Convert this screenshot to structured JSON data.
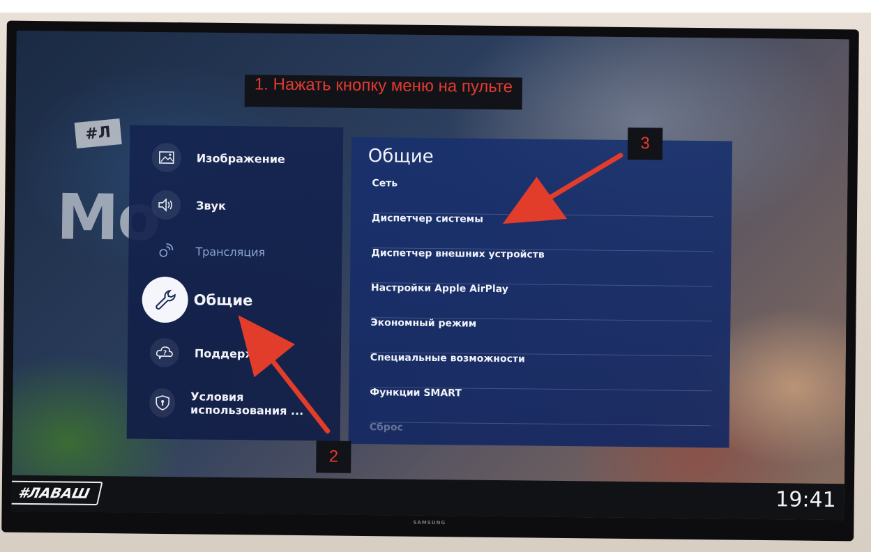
{
  "annotation": {
    "instruction": "1. Нажать кнопку меню на пульте",
    "badge_step2": "2",
    "badge_step3": "3"
  },
  "left_menu": {
    "items": [
      {
        "label": "Изображение",
        "icon": "picture-icon"
      },
      {
        "label": "Звук",
        "icon": "speaker-icon"
      },
      {
        "label": "Трансляция",
        "icon": "broadcast-icon"
      },
      {
        "label": "Общие",
        "icon": "wrench-icon",
        "selected": true
      },
      {
        "label": "Поддерж",
        "icon": "support-cloud-icon"
      },
      {
        "label": "Условия использования ...",
        "icon": "shield-icon"
      }
    ]
  },
  "right_panel": {
    "title": "Общие",
    "items": [
      "Сеть",
      "Диспетчер системы",
      "Диспетчер внешних устройств",
      "Настройки Apple AirPlay",
      "Экономный режим",
      "Специальные возможности",
      "Функции SMART",
      "Сброс"
    ]
  },
  "bottom_bar": {
    "logo": "#ЛАВАШ",
    "clock": "19:41"
  },
  "tv_brand": "SAMSUNG",
  "colors": {
    "annotation_text": "#e33a2e",
    "arrow": "#e23c2b",
    "menu_panel": "#142450",
    "submenu_panel": "#183070"
  }
}
